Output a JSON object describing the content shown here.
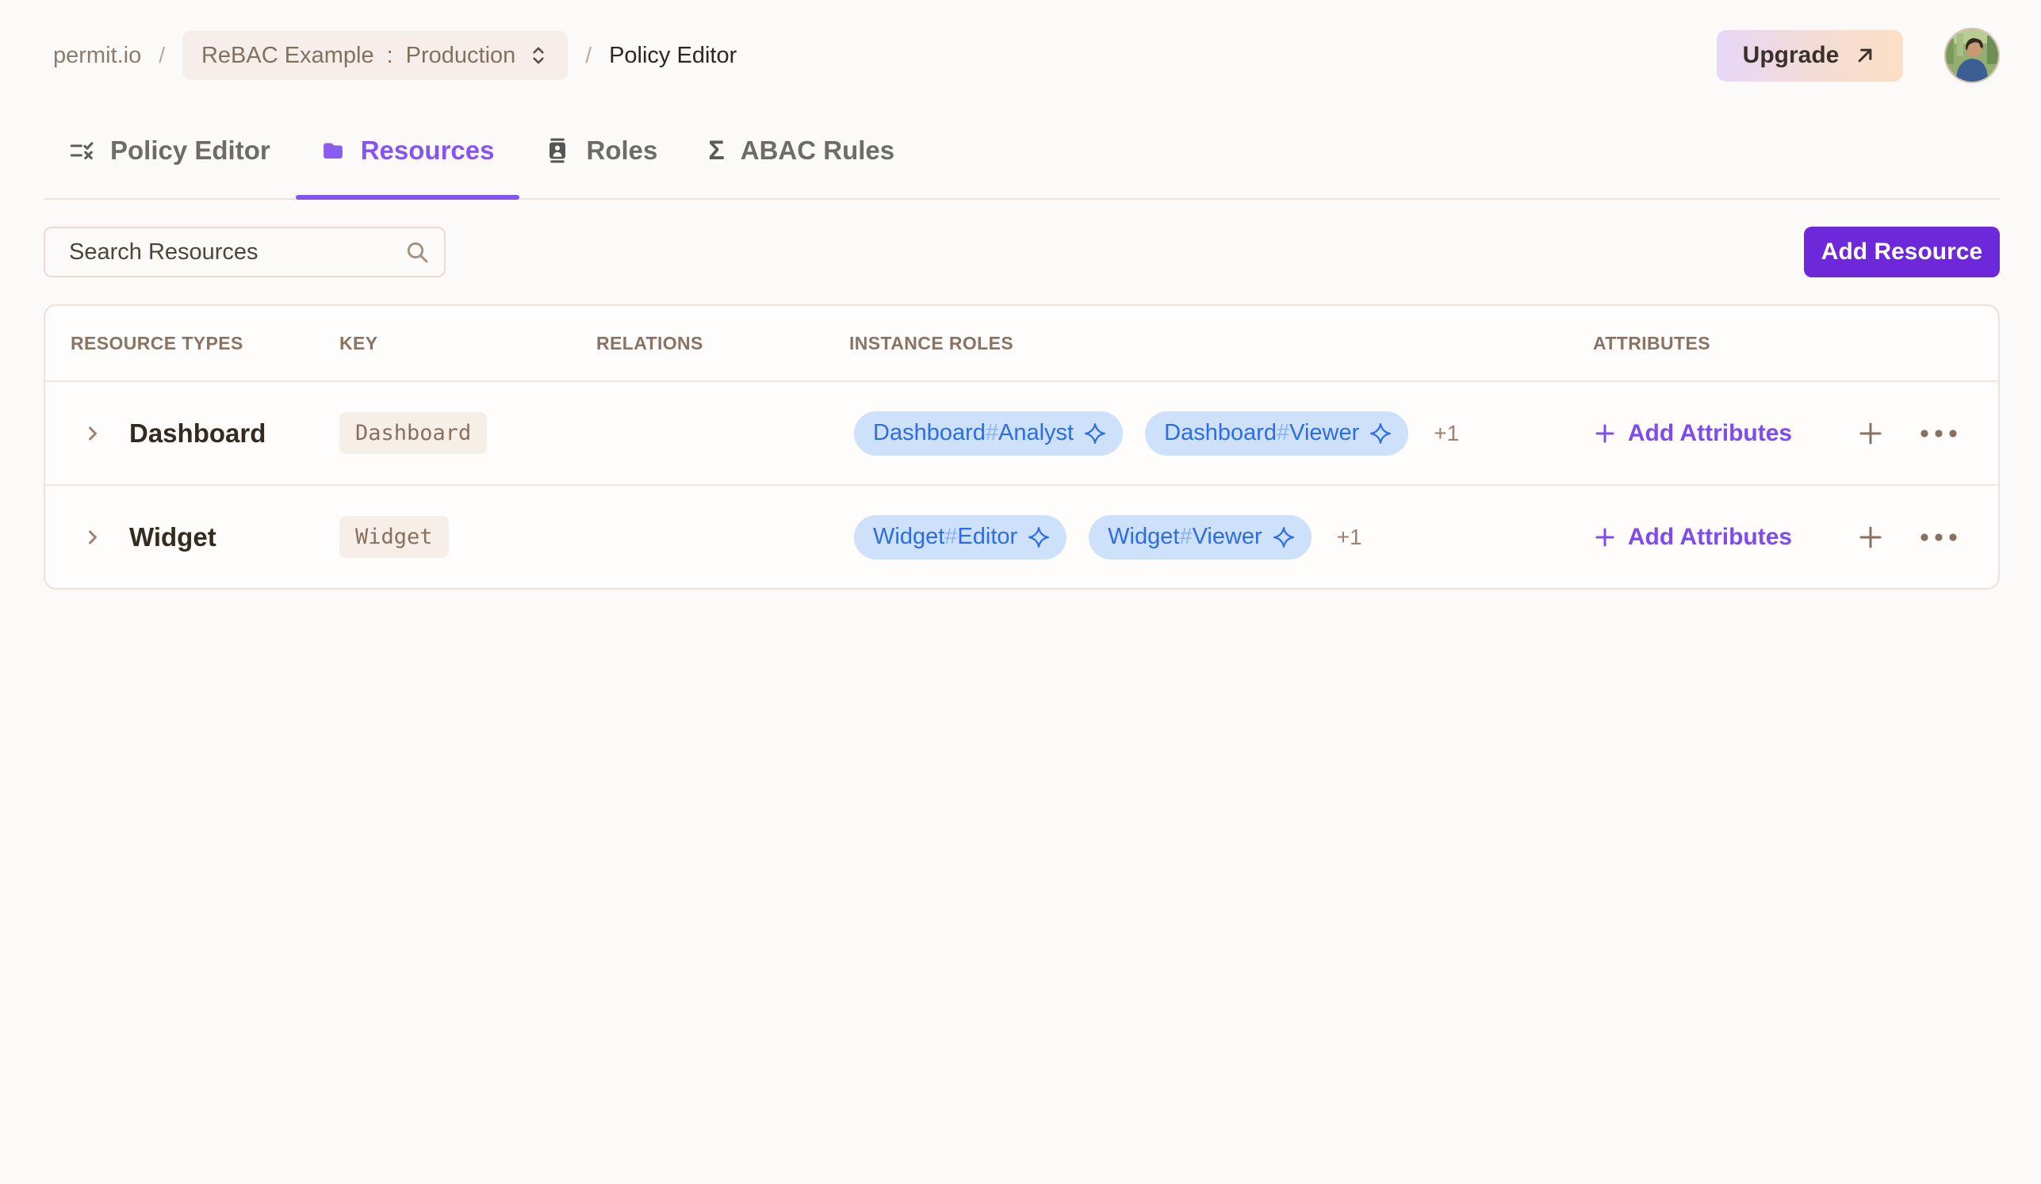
{
  "colors": {
    "page_bg": "#fbfaf8",
    "accent_purple": "#8655f0",
    "add_resource_button_purple": "#6c28d9",
    "add_attributes_purple": "#7d4bee",
    "role_pill_bg": "#cde1fa",
    "role_pill_text": "#2d6ce5",
    "role_pill_hash": "#8ab3f3",
    "muted_brown": "#8b7364",
    "upgrade_gradient_start": "#e7d7f9",
    "upgrade_gradient_end": "#fcdfc4"
  },
  "breadcrumb": {
    "org": "permit.io",
    "separator": "/",
    "project": "ReBAC Example",
    "project_env_separator": ":",
    "environment": "Production",
    "page": "Policy Editor"
  },
  "topbar": {
    "upgrade_label": "Upgrade"
  },
  "tabs": [
    {
      "label": "Policy Editor",
      "active": false
    },
    {
      "label": "Resources",
      "active": true
    },
    {
      "label": "Roles",
      "active": false
    },
    {
      "label": "ABAC Rules",
      "active": false,
      "icon_glyph": "Σ"
    }
  ],
  "toolbar": {
    "search_placeholder": "Search Resources",
    "add_resource_label": "Add Resource"
  },
  "table": {
    "columns": [
      "RESOURCE TYPES",
      "KEY",
      "RELATIONS",
      "INSTANCE ROLES",
      "ATTRIBUTES"
    ],
    "rows": [
      {
        "name": "Dashboard",
        "key": "Dashboard",
        "relations": "",
        "instance_roles": [
          {
            "resource": "Dashboard",
            "separator": "#",
            "role": "Analyst"
          },
          {
            "resource": "Dashboard",
            "separator": "#",
            "role": "Viewer"
          }
        ],
        "more_count": "+1",
        "add_attributes_label": "Add Attributes"
      },
      {
        "name": "Widget",
        "key": "Widget",
        "relations": "",
        "instance_roles": [
          {
            "resource": "Widget",
            "separator": "#",
            "role": "Editor"
          },
          {
            "resource": "Widget",
            "separator": "#",
            "role": "Viewer"
          }
        ],
        "more_count": "+1",
        "add_attributes_label": "Add Attributes"
      }
    ]
  }
}
